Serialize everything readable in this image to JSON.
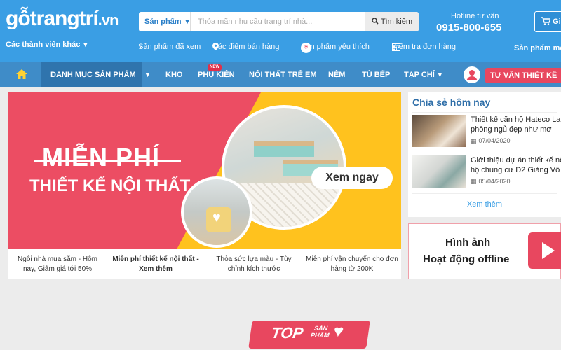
{
  "header": {
    "logo_main": "gỗtrangtrí",
    "logo_domain": ".vn",
    "members_label": "Các thành viên khác",
    "search": {
      "category": "Sản phẩm",
      "placeholder": "Thỏa mãn nhu cầu trang trí nhà...",
      "button": "Tìm kiếm"
    },
    "hotline_label": "Hotline tư vấn",
    "hotline_number": "0915-800-655",
    "cart_label": "Giỏ",
    "links": [
      {
        "label": "Sản phẩm đã xem",
        "icon": "chevron-down-icon"
      },
      {
        "label": "Các điểm bán hàng",
        "icon": "map-pin-icon"
      },
      {
        "label": "Sản phẩm yêu thích",
        "icon": "heart-icon"
      },
      {
        "label": "Kiểm tra đơn hàng",
        "icon": "calendar-icon"
      }
    ],
    "new_products_link": "Sản phẩm mới"
  },
  "nav": {
    "home_icon": "home-icon",
    "category_menu": "DANH MỤC SẢN PHẨM",
    "items": [
      "KHO",
      "PHỤ KIỆN",
      "NỘI THẤT TRẺ EM",
      "NỆM",
      "TỦ BẾP",
      "TẠP CHÍ"
    ],
    "new_badge": "NEW",
    "advise_button": "TƯ VẤN THIẾT KẾ"
  },
  "banner": {
    "line1": "MIỄN PHÍ",
    "line2": "THIẾT KẾ NỘI THẤT",
    "cta": "Xem ngay",
    "captions": [
      "Ngôi nhà mua sắm - Hôm nay, Giảm giá tới 50%",
      "Miễn phí thiết kế nội thất - Xem thêm",
      "Thỏa sức lựa màu - Tùy chỉnh kích thước",
      "Miễn phí vận chuyển cho đơn hàng từ 200K"
    ]
  },
  "share": {
    "title": "Chia sẻ hôm nay",
    "posts": [
      {
        "title_line1": "Thiết kế căn hộ Hateco La",
        "title_line2": "phòng ngủ đẹp như mơ",
        "date": "07/04/2020"
      },
      {
        "title_line1": "Giới thiệu dự án thiết kế nộ",
        "title_line2": "hộ chung cư D2 Giảng Võ",
        "date": "05/04/2020"
      }
    ],
    "more": "Xem thêm"
  },
  "offline": {
    "line1": "Hình ảnh",
    "line2": "Hoạt động offline"
  },
  "top_section": {
    "top": "TOP",
    "sub_line1": "SẢN",
    "sub_line2": "PHẨM"
  },
  "colors": {
    "header_blue": "#3a9ee4",
    "nav_blue": "#3f8cc8",
    "accent_red": "#e8475f",
    "banner_yellow": "#ffc21e"
  }
}
